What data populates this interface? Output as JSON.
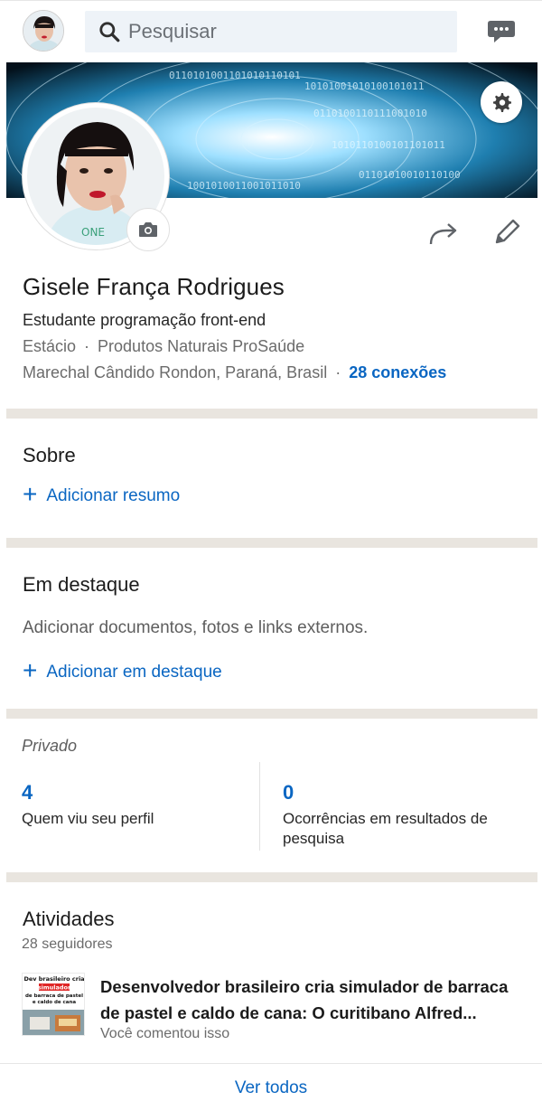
{
  "topbar": {
    "search_placeholder": "Pesquisar",
    "icons": [
      "avatar",
      "search-icon",
      "messaging-icon"
    ]
  },
  "profile": {
    "name": "Gisele França Rodrigues",
    "headline": "Estudante programação front-end",
    "education": "Estácio",
    "company": "Produtos Naturais ProSaúde",
    "location": "Marechal Cândido Rondon, Paraná, Brasil",
    "connections": "28 conexões",
    "separator": "·"
  },
  "about": {
    "title": "Sobre",
    "add_label": "Adicionar resumo"
  },
  "featured": {
    "title": "Em destaque",
    "description": "Adicionar documentos, fotos e links externos.",
    "add_label": "Adicionar em destaque"
  },
  "private_stats": {
    "label": "Privado",
    "views_count": "4",
    "views_label": "Quem viu seu perfil",
    "search_count": "0",
    "search_label": "Ocorrências em resultados de pesquisa"
  },
  "activity": {
    "title": "Atividades",
    "followers": "28 seguidores",
    "post_title": "Desenvolvedor brasileiro cria simulador de barraca de pastel e caldo de cana: O curitibano Alfred...",
    "post_sub": "Você comentou isso",
    "thumb_text": [
      "Dev brasileiro cria",
      "simulador",
      "de barraca de pastel",
      "e caldo de cana"
    ],
    "see_all": "Ver todos"
  },
  "colors": {
    "accent": "#0a66c2",
    "divider": "#e9e5df",
    "search_bg": "#eef3f8"
  }
}
